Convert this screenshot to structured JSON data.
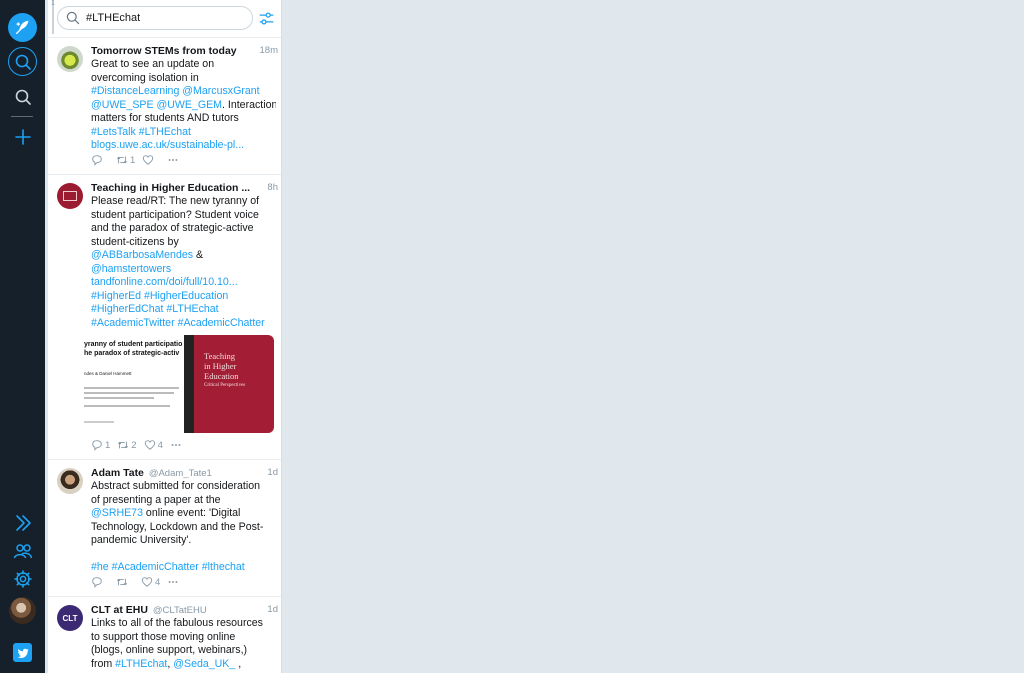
{
  "search": {
    "query": "#LTHEchat"
  },
  "column": {
    "index": "1"
  },
  "icons": {
    "compose": "compose-quill-icon",
    "search": "search-icon",
    "add": "plus-icon",
    "expand": "double-chevron-right-icon",
    "accounts": "people-icon",
    "settings": "gear-icon",
    "logo": "twitter-bird-icon",
    "filter": "sliders-icon",
    "reply": "reply-icon",
    "retweet": "retweet-icon",
    "like": "heart-icon",
    "more": "ellipsis-icon"
  },
  "colors": {
    "accent": "#1da1f2",
    "rail": "#15202b",
    "link": "#1da1f2",
    "muted": "#8899a6"
  },
  "tweets": [
    {
      "name": "Tomorrow STEMs from today",
      "handle": "",
      "time": "18m",
      "lines": [
        [
          {
            "t": "Great to see an update on"
          }
        ],
        [
          {
            "t": "overcoming isolation in"
          }
        ],
        [
          {
            "t": "#DistanceLearning",
            "link": true
          },
          {
            "t": " "
          },
          {
            "t": "@MarcusxGrant",
            "link": true
          }
        ],
        [
          {
            "t": "@UWE_SPE",
            "link": true
          },
          {
            "t": " "
          },
          {
            "t": "@UWE_GEM",
            "link": true
          },
          {
            "t": ". Interaction"
          }
        ],
        [
          {
            "t": "matters for students AND tutors"
          }
        ],
        [
          {
            "t": "#LetsTalk",
            "link": true
          },
          {
            "t": " "
          },
          {
            "t": "#LTHEchat",
            "link": true
          }
        ],
        [
          {
            "t": "blogs.uwe.ac.uk/sustainable-pl...",
            "link": true
          }
        ]
      ],
      "replies": "",
      "retweets": "1",
      "likes": ""
    },
    {
      "name": "Teaching in Higher Education ...",
      "handle": "",
      "time": "8h",
      "lines": [
        [
          {
            "t": "Please read/RT: The new tyranny of"
          }
        ],
        [
          {
            "t": "student participation? Student voice"
          }
        ],
        [
          {
            "t": "and the paradox of strategic-active"
          }
        ],
        [
          {
            "t": "student-citizens by"
          }
        ],
        [
          {
            "t": "@ABBarbosaMendes",
            "link": true
          },
          {
            "t": " &"
          }
        ],
        [
          {
            "t": "@hamstertowers",
            "link": true
          }
        ],
        [
          {
            "t": "tandfonline.com/doi/full/10.10...",
            "link": true
          }
        ],
        [
          {
            "t": "#HigherEd",
            "link": true
          },
          {
            "t": " "
          },
          {
            "t": "#HigherEducation",
            "link": true
          }
        ],
        [
          {
            "t": "#HigherEdChat",
            "link": true
          },
          {
            "t": " "
          },
          {
            "t": "#LTHEchat",
            "link": true
          }
        ],
        [
          {
            "t": "#AcademicTwitter",
            "link": true
          },
          {
            "t": " "
          },
          {
            "t": "#AcademicChatter",
            "link": true
          }
        ]
      ],
      "media": {
        "paper_lines": [
          "yranny of student participatio",
          "he paradox of strategic-activ"
        ],
        "paper_small": [
          "ndes & Daniel Hammett"
        ],
        "book_title": [
          "Teaching",
          "in Higher",
          "Education"
        ],
        "book_subtitle": "Critical Perspectives"
      },
      "replies": "1",
      "retweets": "2",
      "likes": "4"
    },
    {
      "name": "Adam Tate",
      "handle": "@Adam_Tate1",
      "time": "1d",
      "lines": [
        [
          {
            "t": "Abstract submitted for consideration"
          }
        ],
        [
          {
            "t": "of presenting a paper at the"
          }
        ],
        [
          {
            "t": "@SRHE73",
            "link": true
          },
          {
            "t": " online event: 'Digital"
          }
        ],
        [
          {
            "t": "Technology, Lockdown and the Post-"
          }
        ],
        [
          {
            "t": "pandemic University'."
          }
        ],
        [
          {
            "t": " "
          }
        ],
        [
          {
            "t": "#he",
            "link": true
          },
          {
            "t": " "
          },
          {
            "t": "#AcademicChatter",
            "link": true
          },
          {
            "t": " "
          },
          {
            "t": "#lthechat",
            "link": true
          }
        ]
      ],
      "replies": "",
      "retweets": "",
      "likes": "4"
    },
    {
      "name": "CLT at EHU",
      "handle": "@CLTatEHU",
      "time": "1d",
      "lines": [
        [
          {
            "t": "Links to all of the fabulous resources"
          }
        ],
        [
          {
            "t": "to support those moving  online"
          }
        ],
        [
          {
            "t": "(blogs, online support, webinars,)"
          }
        ],
        [
          {
            "t": "from "
          },
          {
            "t": "#LTHEchat",
            "link": true
          },
          {
            "t": ", "
          },
          {
            "t": "@Seda_UK_",
            "link": true
          },
          {
            "t": " ,"
          }
        ]
      ],
      "avatar_text": "CLT",
      "replies": "",
      "retweets": "",
      "likes": ""
    }
  ]
}
